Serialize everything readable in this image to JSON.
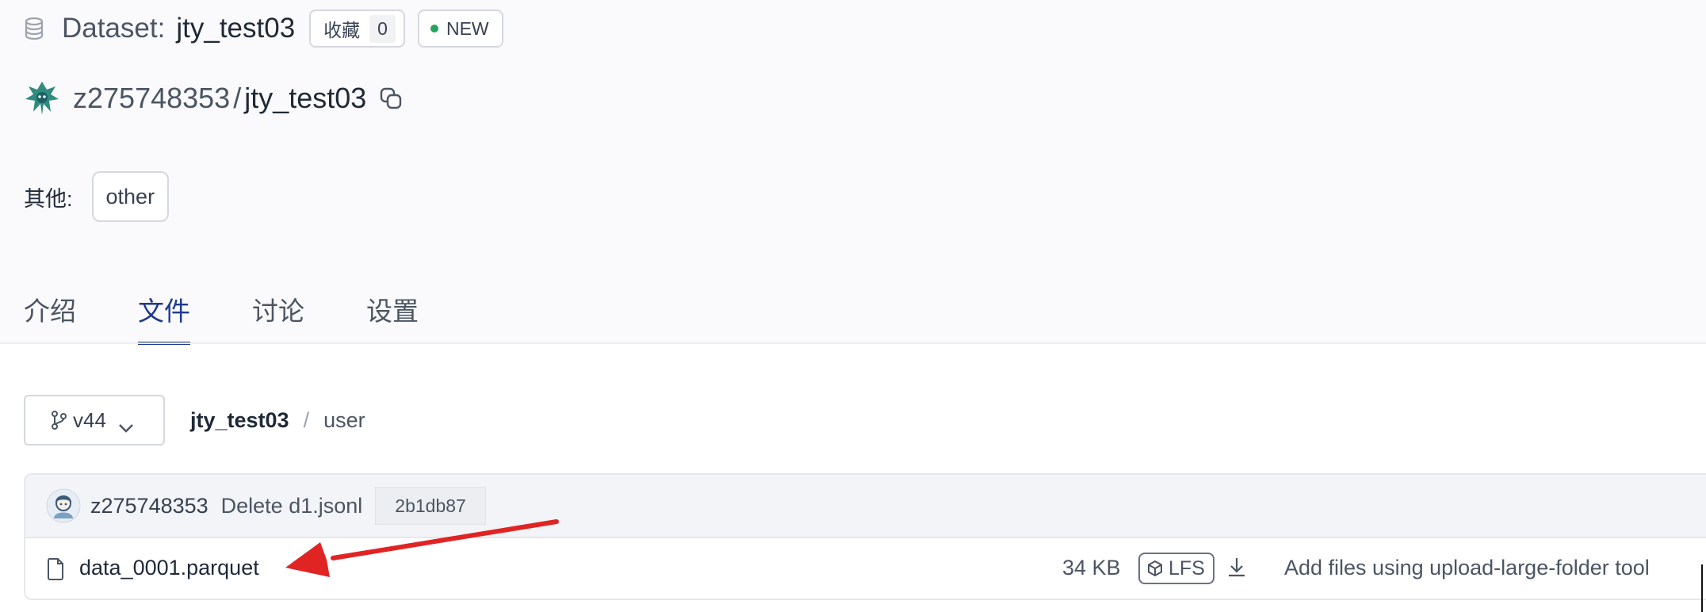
{
  "header": {
    "title_prefix": "Dataset:",
    "dataset_name": "jty_test03",
    "favorite_label": "收藏",
    "favorite_count": "0",
    "new_badge": "NEW",
    "owner": "z275748353",
    "separator": "/",
    "repo": "jty_test03"
  },
  "tags": {
    "label": "其他:",
    "chips": [
      "other"
    ]
  },
  "tabs": [
    {
      "label": "介绍",
      "active": false
    },
    {
      "label": "文件",
      "active": true
    },
    {
      "label": "讨论",
      "active": false
    },
    {
      "label": "设置",
      "active": false
    }
  ],
  "branch": {
    "name": "v44"
  },
  "breadcrumb": {
    "root": "jty_test03",
    "separator": "/",
    "leaf": "user"
  },
  "commit": {
    "user": "z275748353",
    "message": "Delete d1.jsonl",
    "hash": "2b1db87"
  },
  "files": [
    {
      "name": "data_0001.parquet",
      "size": "34 KB",
      "badge": "LFS",
      "commit_message": "Add files using upload-large-folder tool"
    }
  ],
  "icons": {
    "dataset": "database-icon",
    "copy": "copy-icon",
    "branch": "git-branch-icon",
    "chevron": "chevron-down-icon",
    "file": "file-icon",
    "lfs": "cube-icon",
    "download": "download-icon"
  },
  "colors": {
    "accent": "#1e3a8a",
    "new_dot": "#22a55a",
    "annotation_arrow": "#e02424",
    "header_bg": "#fafafc",
    "commit_row_bg": "#f3f4f7"
  }
}
